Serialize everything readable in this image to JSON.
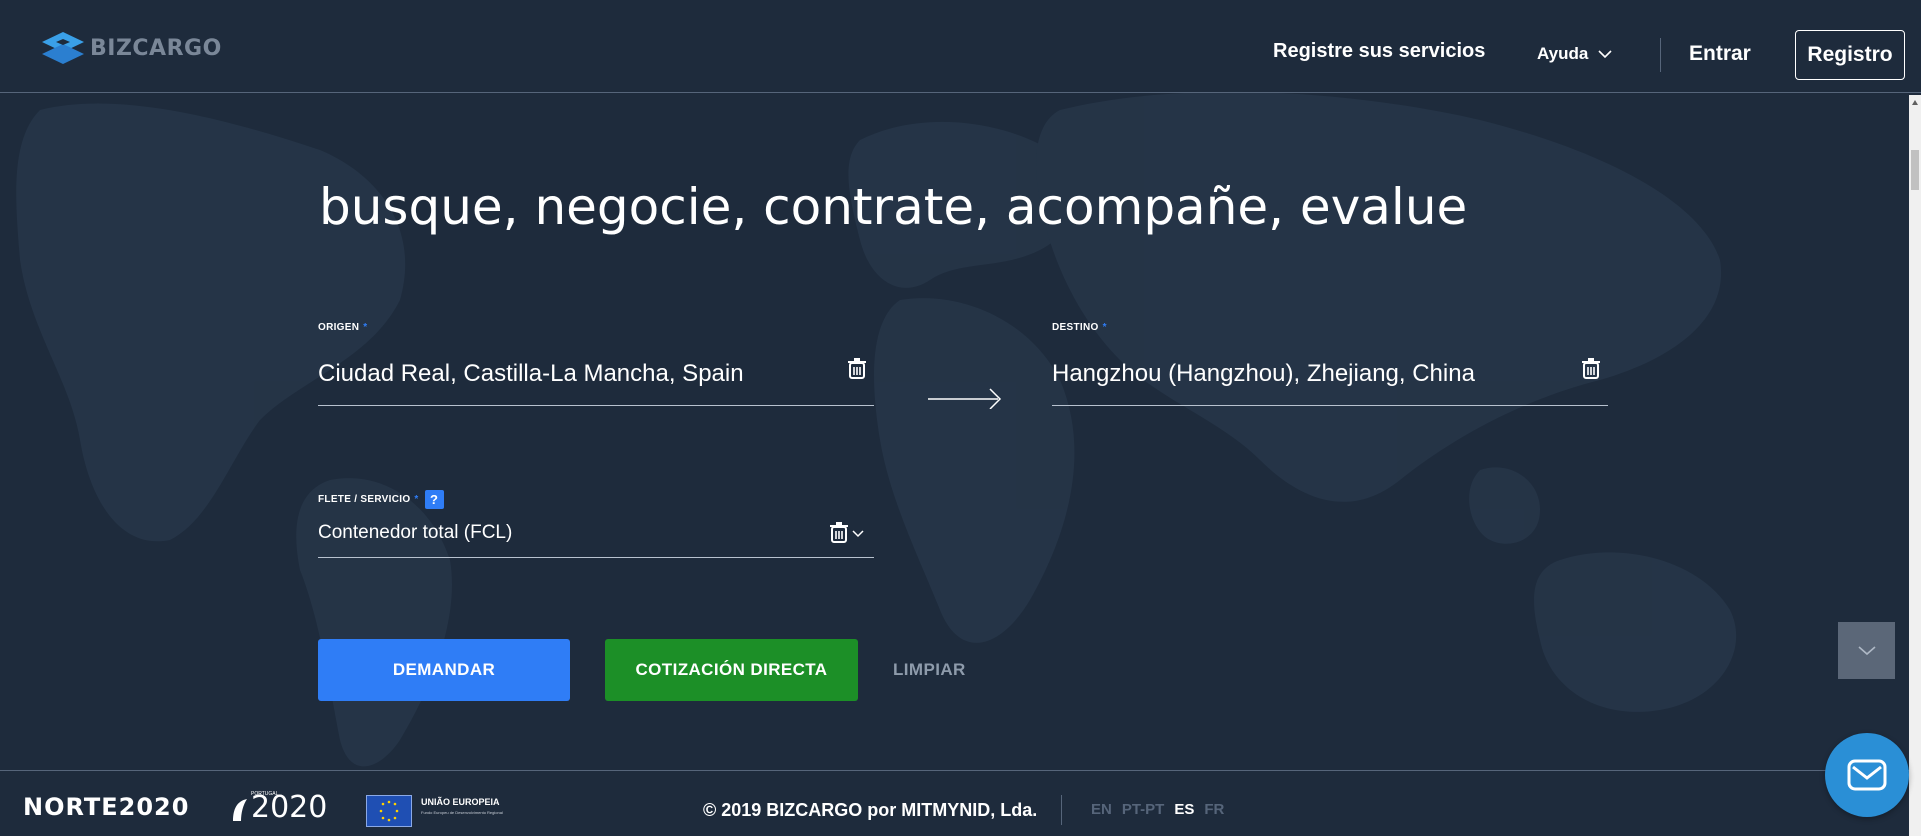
{
  "header": {
    "logo_text": "BIZCARGO",
    "nav": {
      "services": "Registre sus servicios",
      "help": "Ayuda",
      "login": "Entrar",
      "register": "Registro"
    }
  },
  "hero": {
    "title": "busque, negocie, contrate, acompañe, evalue"
  },
  "form": {
    "origin": {
      "label": "ORIGEN",
      "required_mark": "*",
      "value": "Ciudad Real, Castilla-La Mancha, Spain"
    },
    "destination": {
      "label": "DESTINO",
      "required_mark": "*",
      "value": "Hangzhou (Hangzhou), Zhejiang, China"
    },
    "freight": {
      "label": "FLETE / SERVICIO",
      "required_mark": "*",
      "help": "?",
      "value": "Contenedor total (FCL)"
    },
    "buttons": {
      "demand": "DEMANDAR",
      "direct_quote": "COTIZACIÓN DIRECTA",
      "clear": "LIMPIAR"
    }
  },
  "footer": {
    "norte_logo": "NORTE2020",
    "portugal_logo_small": "PORTUGAL",
    "portugal_logo": "2020",
    "eu_title": "UNIÃO EUROPEIA",
    "eu_subtitle": "Fundo Europeu de Desenvolvimento Regional",
    "copyright": "© 2019 BIZCARGO por MITMYNID, Lda.",
    "languages": [
      {
        "code": "EN",
        "active": false
      },
      {
        "code": "PT-PT",
        "active": false
      },
      {
        "code": "ES",
        "active": true
      },
      {
        "code": "FR",
        "active": false
      }
    ]
  },
  "colors": {
    "background": "#1e2b3c",
    "accent_blue": "#2f7df6",
    "accent_green": "#1c8f27",
    "muted": "#8e9bab"
  }
}
